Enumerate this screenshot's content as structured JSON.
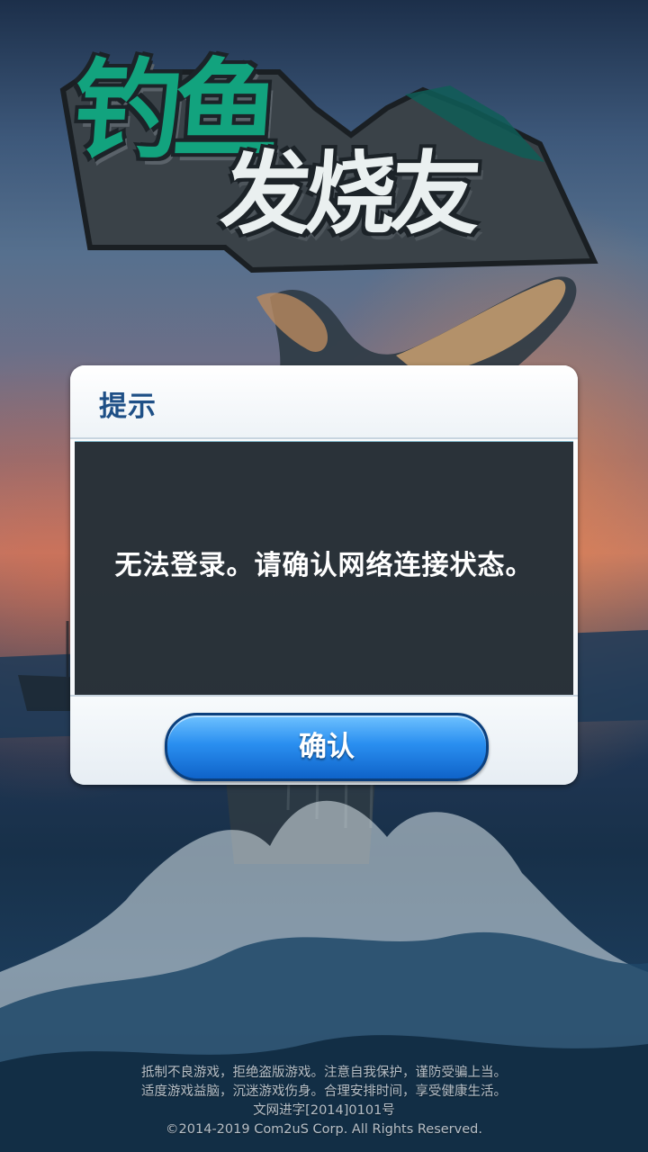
{
  "logo": {
    "title_top": "钓鱼",
    "title_bottom": "发烧友"
  },
  "dialog": {
    "title": "提示",
    "message": "无法登录。请确认网络连接状态。",
    "confirm_label": "确认"
  },
  "footer": {
    "notice_line1": "抵制不良游戏，拒绝盗版游戏。注意自我保护，谨防受骗上当。",
    "notice_line2": "适度游戏益脑，沉迷游戏伤身。合理安排时间，享受健康生活。",
    "license": "文网进字[2014]0101号",
    "copyright": "©2014-2019 Com2uS Corp. All Rights Reserved."
  },
  "colors": {
    "dialog_title": "#1e4f86",
    "button_blue": "#2a8ff0",
    "logo_green": "#12a37e"
  }
}
